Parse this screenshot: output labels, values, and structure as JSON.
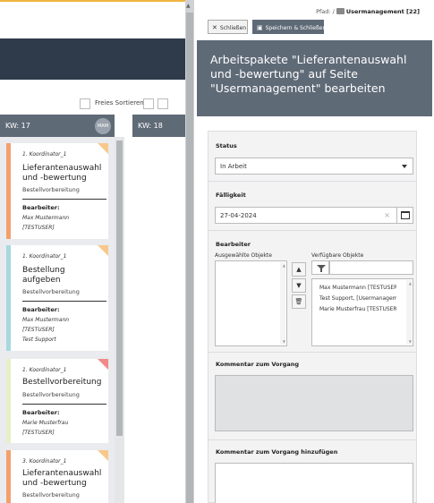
{
  "board": {
    "sort_label": "Freies Sortieren",
    "columns": [
      {
        "label": "KW: 17",
        "badge": "MAM"
      },
      {
        "label": "KW: 18"
      }
    ],
    "cards": [
      {
        "coordinator": "1. Koordinator_1",
        "title": "Lieferantenauswahl und -bewertung",
        "subtitle": "Bestellvorbereitung",
        "assignee_label": "Bearbeiter:",
        "assignees": [
          "Max Mustermann",
          "[TESTUSER]"
        ],
        "color": "#f3a06b"
      },
      {
        "coordinator": "1. Koordinator_1",
        "title": "Bestellung aufgeben",
        "subtitle": "Bestellvorbereitung",
        "assignee_label": "Bearbeiter:",
        "assignees": [
          "Max Mustermann",
          "[TESTUSER]",
          "Test Support"
        ],
        "color": "#a8d8e0"
      },
      {
        "coordinator": "1. Koordinator_1",
        "title": "Bestellvorbereitung",
        "subtitle": "Bestellvorbereitung",
        "assignee_label": "Bearbeiter:",
        "assignees": [
          "Marie Musterfrau",
          "[TESTUSER]"
        ],
        "color": "#e6efc8"
      },
      {
        "coordinator": "3. Koordinator_1",
        "title": "Lieferantenauswahl und -bewertung",
        "subtitle": "Bestellvorbereitung",
        "assignee_label": "",
        "assignees": [],
        "color": "#f3a06b"
      }
    ]
  },
  "panel": {
    "path_prefix": "Pfad: /",
    "path_current": "Usermanagement [22]",
    "close_label": "Schließen",
    "save_label": "Speichern & Schließen",
    "title": "Arbeitspakete \"Lieferantenauswahl und -bewertung\" auf Seite \"Usermanagement\" bearbeiten",
    "status_label": "Status",
    "status_value": "In Arbeit",
    "due_label": "Fälligkeit",
    "due_value": "27-04-2024",
    "assignee_label": "Bearbeiter",
    "selected_label": "Ausgewählte Objekte",
    "available_label": "Verfügbare Objekte",
    "available_items": [
      "Max Mustermann [TESTUSER]",
      "Test Support, [Usermanagement]",
      "Marie Musterfrau [TESTUSER]"
    ],
    "comment_label": "Kommentar zum Vorgang",
    "add_comment_label": "Kommentar zum Vorgang hinzufügen"
  },
  "colors": {
    "header_dark": "#2f3a4a",
    "panel_slate": "#5f6a77",
    "accent_orange": "#f3a06b",
    "accent_blue": "#a8d8e0",
    "accent_green": "#e6efc8"
  }
}
